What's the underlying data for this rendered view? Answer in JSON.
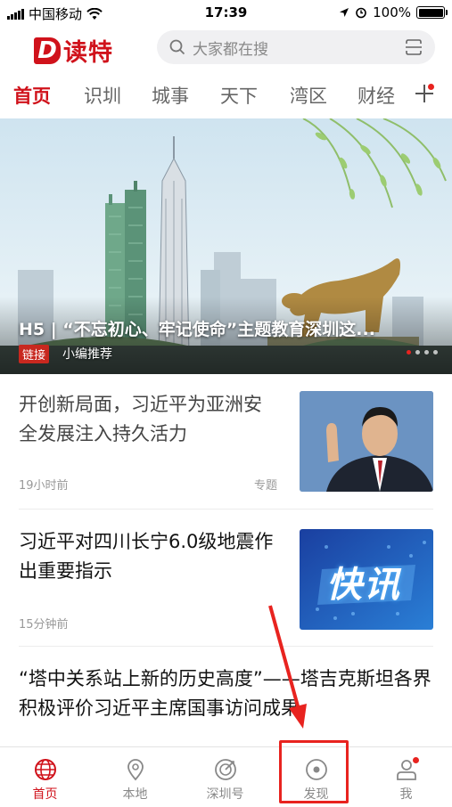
{
  "status_bar": {
    "carrier": "中国移动",
    "time": "17:39",
    "battery": "100%"
  },
  "header": {
    "logo_letter": "D",
    "logo_text": "读特",
    "search_placeholder": "大家都在搜"
  },
  "tabs": [
    "首页",
    "识圳",
    "城事",
    "天下",
    "湾区",
    "财经"
  ],
  "active_tab": "首页",
  "banner": {
    "title": "H5 | “不忘初心、牢记使命”主题教育深圳这...",
    "tag": "链接",
    "source": "小编推荐"
  },
  "news": [
    {
      "title": "开创新局面，习近平为亚洲安全发展注入持久活力",
      "time": "19小时前",
      "tag": "专题"
    },
    {
      "title": "习近平对四川长宁6.0级地震作出重要指示",
      "time": "15分钟前",
      "thumb_text": "快讯"
    },
    {
      "title": "“塔中关系站上新的历史高度”——塔吉克斯坦各界积极评价习近平主席国事访问成果"
    }
  ],
  "bottom_nav": [
    {
      "label": "首页",
      "icon": "globe-icon"
    },
    {
      "label": "本地",
      "icon": "location-pin-icon"
    },
    {
      "label": "深圳号",
      "icon": "radar-icon"
    },
    {
      "label": "发现",
      "icon": "discover-icon"
    },
    {
      "label": "我",
      "icon": "user-icon"
    }
  ],
  "colors": {
    "brand_red": "#d0121b",
    "highlight_red": "#e8231f"
  }
}
